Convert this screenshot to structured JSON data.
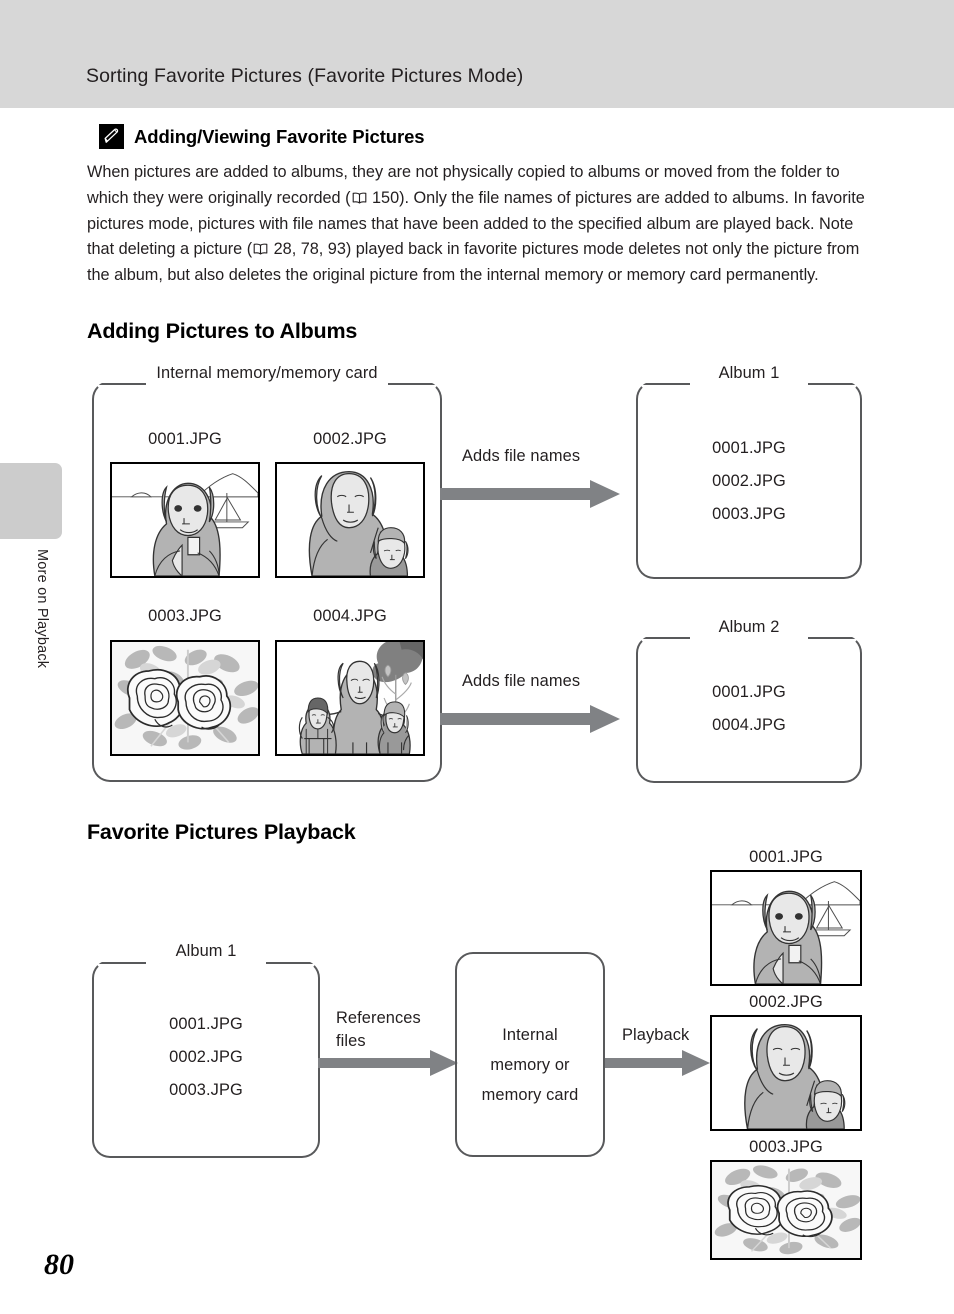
{
  "header": {
    "title": "Sorting Favorite Pictures (Favorite Pictures Mode)"
  },
  "side_tab": {
    "label": "More on Playback"
  },
  "note": {
    "icon": "pencil-icon",
    "heading": "Adding/Viewing Favorite Pictures",
    "body_part1": "When pictures are added to albums, they are not physically copied to albums or moved from the folder to which they were originally recorded (",
    "ref1": " 150). Only the file names of pictures are added to albums. In favorite pictures mode, pictures with file names that have been added to the specified album are played back. Note that deleting a picture (",
    "ref2": " 28, 78, 93) played back in favorite pictures mode deletes not only the picture from the album, but also deletes the original picture from the internal memory or memory card permanently."
  },
  "section_adding": {
    "heading": "Adding Pictures to Albums",
    "source_box_caption": "Internal memory/memory card",
    "thumbnails": [
      {
        "label": "0001.JPG",
        "art": "woman-sailboat"
      },
      {
        "label": "0002.JPG",
        "art": "woman-child"
      },
      {
        "label": "0003.JPG",
        "art": "flowers"
      },
      {
        "label": "0004.JPG",
        "art": "family-tree"
      }
    ],
    "arrows": [
      {
        "label": "Adds file names"
      },
      {
        "label": "Adds file names"
      }
    ],
    "albums": [
      {
        "caption": "Album 1",
        "files": [
          "0001.JPG",
          "0002.JPG",
          "0003.JPG"
        ]
      },
      {
        "caption": "Album 2",
        "files": [
          "0001.JPG",
          "0004.JPG"
        ]
      }
    ]
  },
  "section_playback": {
    "heading": "Favorite Pictures Playback",
    "album": {
      "caption": "Album 1",
      "files": [
        "0001.JPG",
        "0002.JPG",
        "0003.JPG"
      ]
    },
    "arrow1_label_line1": "References",
    "arrow1_label_line2": "files",
    "memory_box_line1": "Internal",
    "memory_box_line2": "memory or",
    "memory_box_line3": "memory card",
    "arrow2_label": "Playback",
    "outputs": [
      {
        "label": "0001.JPG",
        "art": "woman-sailboat"
      },
      {
        "label": "0002.JPG",
        "art": "woman-child"
      },
      {
        "label": "0003.JPG",
        "art": "flowers"
      }
    ]
  },
  "footer": {
    "page_number": "80"
  },
  "colors": {
    "header_band": "#d7d7d7",
    "side_tab": "#cccccc",
    "box_stroke": "#58595b",
    "arrow": "#808285",
    "text": "#231f20"
  }
}
